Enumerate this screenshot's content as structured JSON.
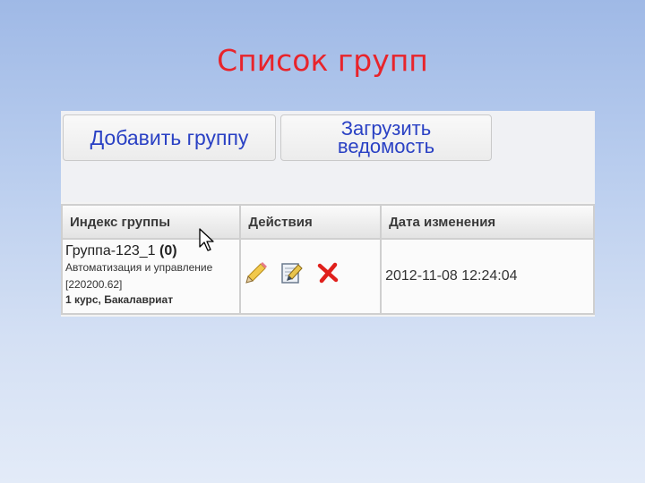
{
  "slide": {
    "title": "Список групп"
  },
  "toolbar": {
    "add_label": "Добавить группу",
    "upload_label_line1": "Загрузить",
    "upload_label_line2": "ведомость"
  },
  "table": {
    "headers": [
      "Индекс группы",
      "Действия",
      "Дата изменения"
    ],
    "rows": [
      {
        "group_name": "Группа-123_1",
        "group_count": "(0)",
        "specialty": "Автоматизация и управление",
        "code": "[220200.62]",
        "course": "1 курс, Бакалавриат",
        "actions": [
          "pencil-icon",
          "edit-icon",
          "delete-icon"
        ],
        "modified": "2012-11-08 12:24:04"
      }
    ]
  },
  "colors": {
    "title": "#e8242b",
    "button_text": "#2a41c4",
    "delete": "#e0201c"
  }
}
